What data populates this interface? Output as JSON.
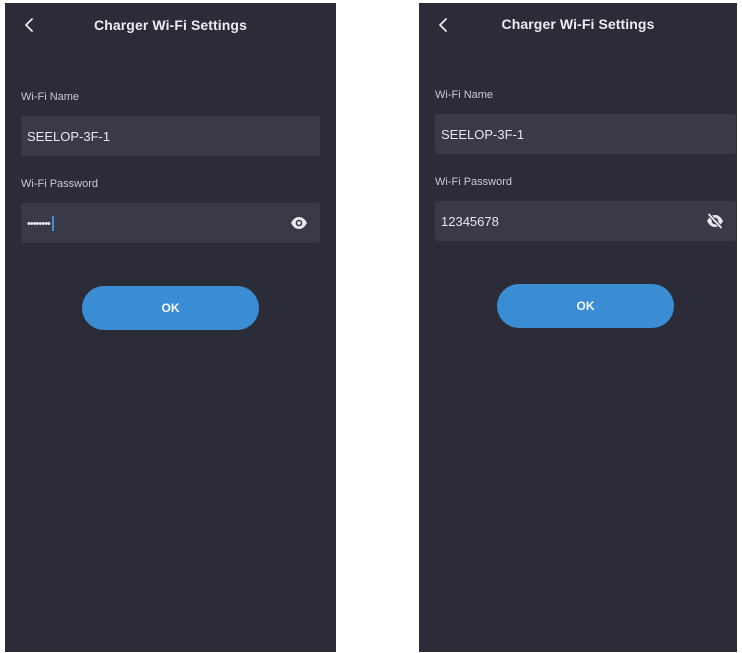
{
  "screens": [
    {
      "title": "Charger Wi-Fi Settings",
      "wifi_name_label": "Wi-Fi Name",
      "wifi_name_value": "SEELOP-3F-1",
      "wifi_password_label": "Wi-Fi Password",
      "wifi_password_value": "••••••••",
      "password_visible": false,
      "visibility_icon": "eye-icon",
      "ok_label": "OK"
    },
    {
      "title": "Charger Wi-Fi Settings",
      "wifi_name_label": "Wi-Fi Name",
      "wifi_name_value": "SEELOP-3F-1",
      "wifi_password_label": "Wi-Fi Password",
      "wifi_password_value": "12345678",
      "password_visible": true,
      "visibility_icon": "eye-off-icon",
      "ok_label": "OK"
    }
  ],
  "colors": {
    "background": "#2c2b38",
    "field": "#3a3947",
    "accent": "#3b8dd3",
    "text": "#e8e8ee"
  }
}
